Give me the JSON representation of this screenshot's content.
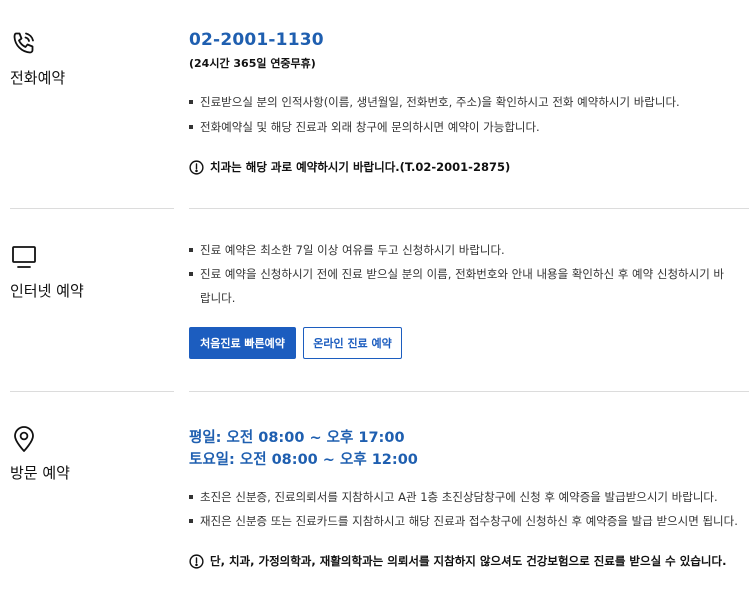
{
  "phone_reservation": {
    "title": "전화예약",
    "icon": "phone-icon",
    "phone_number": "02-2001-1130",
    "availability": "(24시간 365일 연중무휴)",
    "bullets": [
      "진료받으실 분의 인적사항(이름, 생년월일, 전화번호, 주소)을 확인하시고 전화 예약하시기 바랍니다.",
      "전화예약실 및 해당 진료과 외래 창구에 문의하시면 예약이 가능합니다."
    ],
    "notice": "치과는 해당 과로 예약하시기 바랍니다.(T.02-2001-2875)"
  },
  "internet_reservation": {
    "title": "인터넷 예약",
    "icon": "monitor-icon",
    "bullets": [
      "진료 예약은 최소한 7일 이상 여유를 두고 신청하시기 바랍니다.",
      "진료 예약을 신청하시기 전에 진료 받으실 분의 이름, 전화번호와 안내 내용을 확인하신 후 예약 신청하시기 바랍니다."
    ],
    "primary_button": "처음진료 빠른예약",
    "secondary_button": "온라인 진료 예약"
  },
  "visit_reservation": {
    "title": "방문 예약",
    "icon": "location-pin-icon",
    "weekday_hours": "평일: 오전 08:00 ~ 오후 17:00",
    "saturday_hours": "토요일: 오전 08:00 ~ 오후 12:00",
    "bullets": [
      "초진은 신분증, 진료의뢰서를 지참하시고 A관 1층 초진상담창구에 신청 후 예약증을 발급받으시기 바랍니다.",
      "재진은 신분증 또는 진료카드를 지참하시고 해당 진료과 접수창구에 신청하신 후 예약증을 발급 받으시면 됩니다."
    ],
    "notice": "단, 치과, 가정의학과, 재활의학과는 의뢰서를 지참하지 않으셔도 건강보험으로 진료를 받으실 수 있습니다."
  },
  "colors": {
    "accent_blue": "#1c5dbf",
    "heading_blue": "#1f5fb0",
    "divider": "#dcdcdc"
  }
}
